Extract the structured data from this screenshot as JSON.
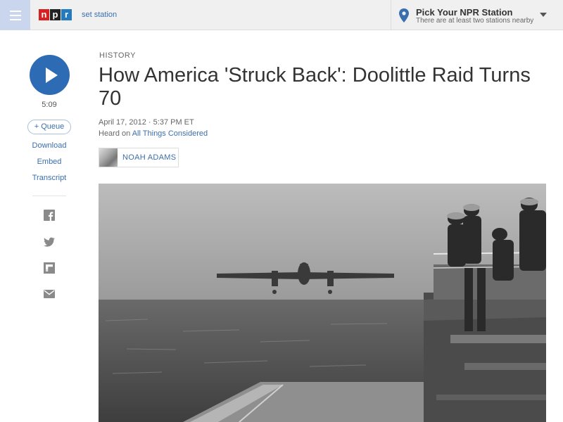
{
  "header": {
    "menu_icon": "hamburger-menu-icon",
    "logo_letters": [
      "n",
      "p",
      "r"
    ],
    "set_station": "set station",
    "station_picker": {
      "title": "Pick Your NPR Station",
      "subtitle": "There are at least two stations nearby"
    }
  },
  "player": {
    "duration": "5:09",
    "queue_label": "+ Queue",
    "links": [
      "Download",
      "Embed",
      "Transcript"
    ]
  },
  "share": [
    "facebook-icon",
    "twitter-icon",
    "flipboard-icon",
    "email-icon"
  ],
  "article": {
    "slug": "HISTORY",
    "headline": "How America 'Struck Back': Doolittle Raid Turns 70",
    "dateline": "April 17, 2012 · 5:37 PM ET",
    "heard_on_prefix": "Heard on ",
    "heard_on_show": "All Things Considered",
    "byline": "NOAH ADAMS"
  },
  "colors": {
    "accent": "#2d6bb5",
    "link": "#3a6fad",
    "npr_red": "#d62021",
    "npr_blue": "#237bbd"
  }
}
